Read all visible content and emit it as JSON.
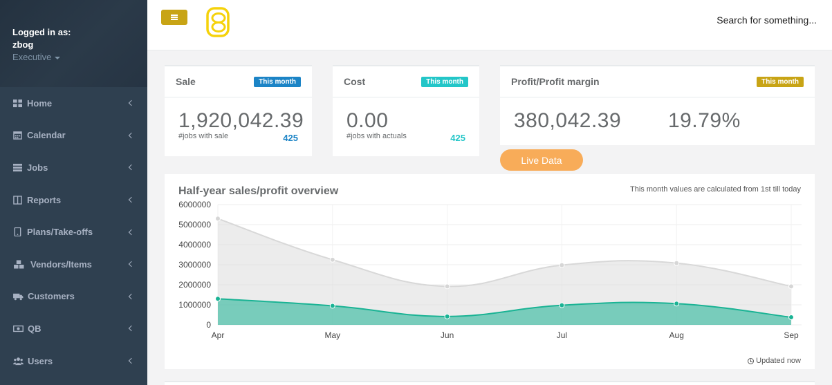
{
  "profile": {
    "logged_in_label": "Logged in as:",
    "username": "zbog",
    "role": "Executive"
  },
  "sidebar": {
    "items": [
      {
        "label": "Home",
        "icon": "th-large-icon"
      },
      {
        "label": "Calendar",
        "icon": "calendar-icon"
      },
      {
        "label": "Jobs",
        "icon": "tasks-icon"
      },
      {
        "label": "Reports",
        "icon": "columns-icon"
      },
      {
        "label": "Plans/Take-offs",
        "icon": "tablet-icon"
      },
      {
        "label": "Vendors/Items",
        "icon": "cubes-icon"
      },
      {
        "label": "Customers",
        "icon": "truck-icon"
      },
      {
        "label": "QB",
        "icon": "money-icon"
      },
      {
        "label": "Users",
        "icon": "users-icon"
      }
    ]
  },
  "topbar": {
    "search_placeholder": "Search for something..."
  },
  "widgets": {
    "sale": {
      "title": "Sale",
      "badge": "This month",
      "value": "1,920,042.39",
      "sub": "#jobs with sale",
      "count": "425",
      "badge_color": "#1c84c6",
      "count_color": "#1c84c6"
    },
    "cost": {
      "title": "Cost",
      "badge": "This month",
      "value": "0.00",
      "sub": "#jobs with actuals",
      "count": "425",
      "badge_color": "#23c6c8",
      "count_color": "#23c6c8"
    },
    "profit": {
      "title": "Profit/Profit margin",
      "badge": "This month",
      "value": "380,042.39",
      "margin": "19.79%",
      "badge_color": "#c8a415"
    }
  },
  "live_button": "Live Data",
  "chart_panel": {
    "title": "Half-year sales/profit overview",
    "note": "This month values are calculated from 1st till today",
    "updated": "Updated now"
  },
  "chart_data": {
    "type": "area",
    "categories": [
      "Apr",
      "May",
      "Jun",
      "Jul",
      "Aug",
      "Sep"
    ],
    "series": [
      {
        "name": "",
        "values": [
          5300000,
          3250000,
          1920000,
          2980000,
          3080000,
          1920000
        ],
        "color": "#dcdcdc"
      },
      {
        "name": "",
        "values": [
          1300000,
          950000,
          420000,
          980000,
          1060000,
          380000
        ],
        "color": "#1ab394"
      }
    ],
    "ylim": [
      0,
      6000000
    ],
    "yticks": [
      "0",
      "1000000",
      "2000000",
      "3000000",
      "4000000",
      "5000000",
      "6000000"
    ],
    "grid": true
  }
}
